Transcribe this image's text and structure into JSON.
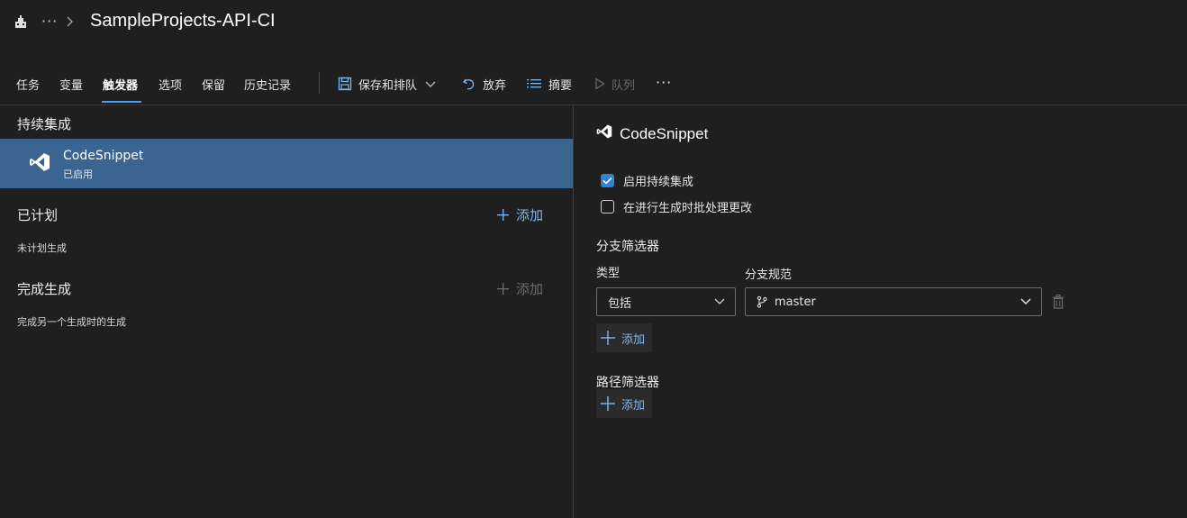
{
  "header": {
    "more_label": "···",
    "title": "SampleProjects-API-CI"
  },
  "tabs": [
    {
      "label": "任务"
    },
    {
      "label": "变量"
    },
    {
      "label": "触发器"
    },
    {
      "label": "选项"
    },
    {
      "label": "保留"
    },
    {
      "label": "历史记录"
    }
  ],
  "toolbar": {
    "save_queue_label": "保存和排队",
    "discard_label": "放弃",
    "summary_label": "摘要",
    "queue_label": "队列",
    "more_label": "···"
  },
  "left": {
    "ci_section_title": "持续集成",
    "ci_item": {
      "name": "CodeSnippet",
      "status": "已启用"
    },
    "scheduled": {
      "title": "已计划",
      "add_label": "添加",
      "empty_text": "未计划生成"
    },
    "completion": {
      "title": "完成生成",
      "add_label": "添加",
      "desc": "完成另一个生成时的生成"
    }
  },
  "right": {
    "title": "CodeSnippet",
    "enable_ci": {
      "label": "启用持续集成",
      "checked": true
    },
    "batch_changes": {
      "label": "在进行生成时批处理更改",
      "checked": false
    },
    "branch_filters": {
      "title": "分支筛选器",
      "type_label": "类型",
      "spec_label": "分支规范",
      "type_value": "包括",
      "spec_value": "master",
      "add_label": "添加"
    },
    "path_filters": {
      "title": "路径筛选器",
      "add_label": "添加"
    }
  },
  "colors": {
    "background": "#1f1f1f",
    "selected_item": "#3a6590",
    "accent": "#4aa0f0",
    "checkbox_on": "#2f82d6"
  }
}
